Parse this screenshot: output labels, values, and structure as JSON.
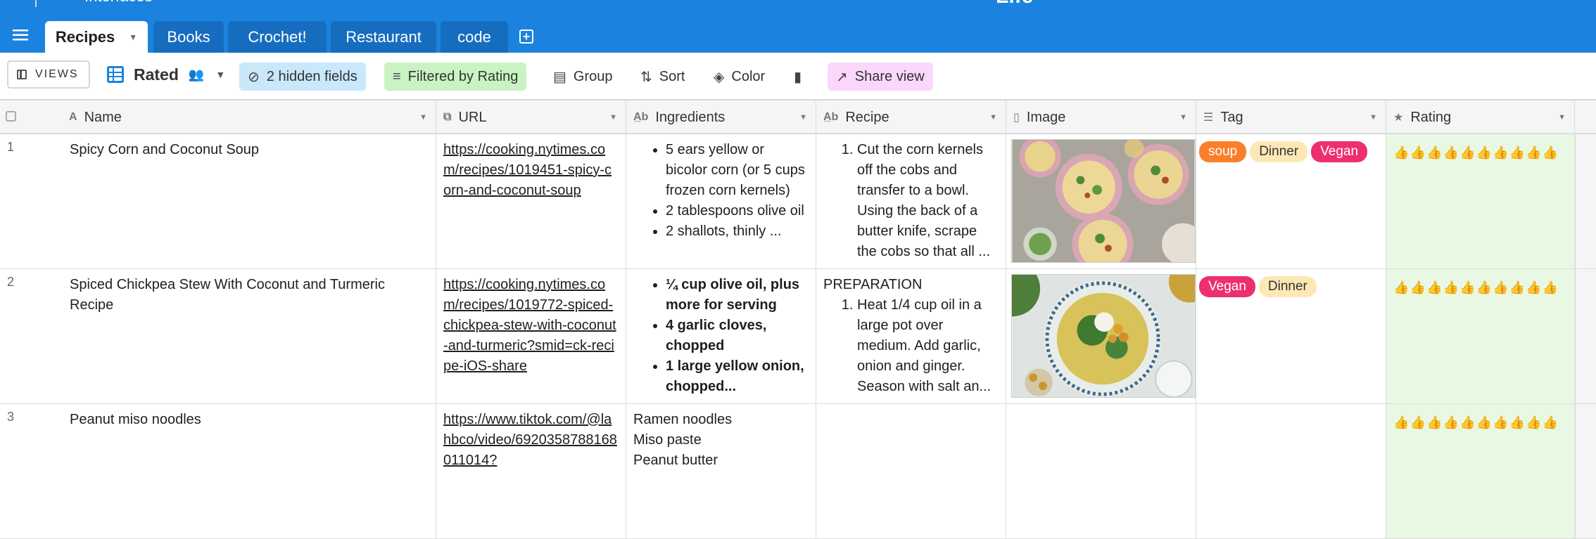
{
  "app": {
    "interfaces_label": "Interfaces",
    "base_title": "Life"
  },
  "tabs": [
    {
      "label": "Recipes"
    },
    {
      "label": "Books"
    },
    {
      "label": "Crochet!"
    },
    {
      "label": "Restaurant"
    },
    {
      "label": "code"
    }
  ],
  "toolbar": {
    "views_label": "VIEWS",
    "view_name": "Rated",
    "hidden_fields_label": "2 hidden fields",
    "filter_label": "Filtered by Rating",
    "group_label": "Group",
    "sort_label": "Sort",
    "color_label": "Color",
    "share_label": "Share view"
  },
  "columns": [
    {
      "label": "Name"
    },
    {
      "label": "URL"
    },
    {
      "label": "Ingredients"
    },
    {
      "label": "Recipe"
    },
    {
      "label": "Image"
    },
    {
      "label": "Tag"
    },
    {
      "label": "Rating"
    }
  ],
  "rows": [
    {
      "num": "1",
      "name": "Spicy Corn and Coconut Soup",
      "url": "https://cooking.nytimes.com/recipes/1019451-spicy-corn-and-coconut-soup",
      "ingredients": [
        "5 ears yellow or bicolor corn (or 5 cups frozen corn kernels)",
        "2 tablespoons olive oil",
        "2 shallots, thinly ..."
      ],
      "recipe_heading": "",
      "recipe_steps": [
        "Cut the corn kernels off the cobs and transfer to a bowl. Using the back of a butter knife, scrape the cobs so that all ..."
      ],
      "image_desc": "corn soup bowls",
      "tags": [
        {
          "label": "soup",
          "bg": "#f97f2a",
          "fg": "#ffffff"
        },
        {
          "label": "Dinner",
          "bg": "#fde8b5",
          "fg": "#333333"
        },
        {
          "label": "Vegan",
          "bg": "#ee2f6e",
          "fg": "#ffffff"
        }
      ],
      "rating": 9,
      "rating_max": 10
    },
    {
      "num": "2",
      "name": "Spiced Chickpea Stew With Coconut and Turmeric Recipe",
      "url": "https://cooking.nytimes.com/recipes/1019772-spiced-chickpea-stew-with-coconut-and-turmeric?smid=ck-recipe-iOS-share",
      "ingredients": [
        "¼ cup olive oil, plus more for serving",
        "4 garlic cloves, chopped",
        "1 large yellow onion, chopped..."
      ],
      "recipe_heading": "PREPARATION",
      "recipe_steps": [
        "Heat 1/4 cup oil in a large pot over medium. Add garlic, onion and ginger. Season with salt an..."
      ],
      "image_desc": "chickpea stew bowl",
      "tags": [
        {
          "label": "Vegan",
          "bg": "#ee2f6e",
          "fg": "#ffffff"
        },
        {
          "label": "Dinner",
          "bg": "#fde8b5",
          "fg": "#333333"
        }
      ],
      "rating": 9,
      "rating_max": 10
    },
    {
      "num": "3",
      "name": "Peanut miso noodles",
      "url": "https://www.tiktok.com/@lahbco/video/6920358788168011014?",
      "ingredients_plain": [
        "Ramen noodles",
        "Miso paste",
        "Peanut butter"
      ],
      "tags": [],
      "rating": 9,
      "rating_max": 10
    }
  ],
  "colors": {
    "brand_blue": "#1b83df",
    "rating_bg": "#e9f8e2",
    "thumb_green": "#2db82d"
  }
}
